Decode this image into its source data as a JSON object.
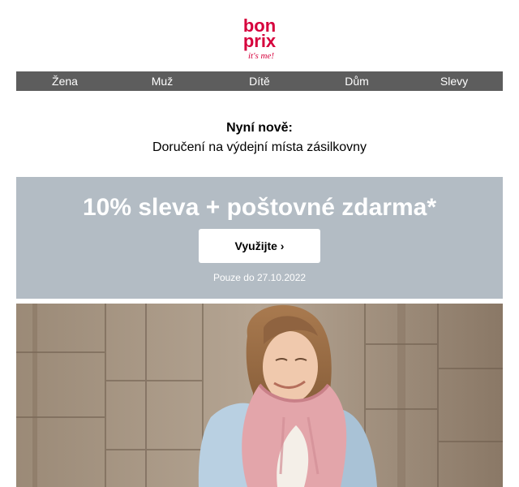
{
  "brand": {
    "logo_top": "bon",
    "logo_bottom": "prix",
    "tagline": "it's me!",
    "color": "#d6003c"
  },
  "nav": {
    "items": [
      {
        "label": "Žena"
      },
      {
        "label": "Muž"
      },
      {
        "label": "Dítě"
      },
      {
        "label": "Dům"
      },
      {
        "label": "Slevy"
      }
    ]
  },
  "notice": {
    "title": "Nyní nově:",
    "text": "Doručení na výdejní místa zásilkovny"
  },
  "promo": {
    "headline": "10% sleva + poštovné zdarma*",
    "button_label": "Využijte ›",
    "note": "Pouze do 27.10.2022",
    "background": "#b3bcc4"
  }
}
